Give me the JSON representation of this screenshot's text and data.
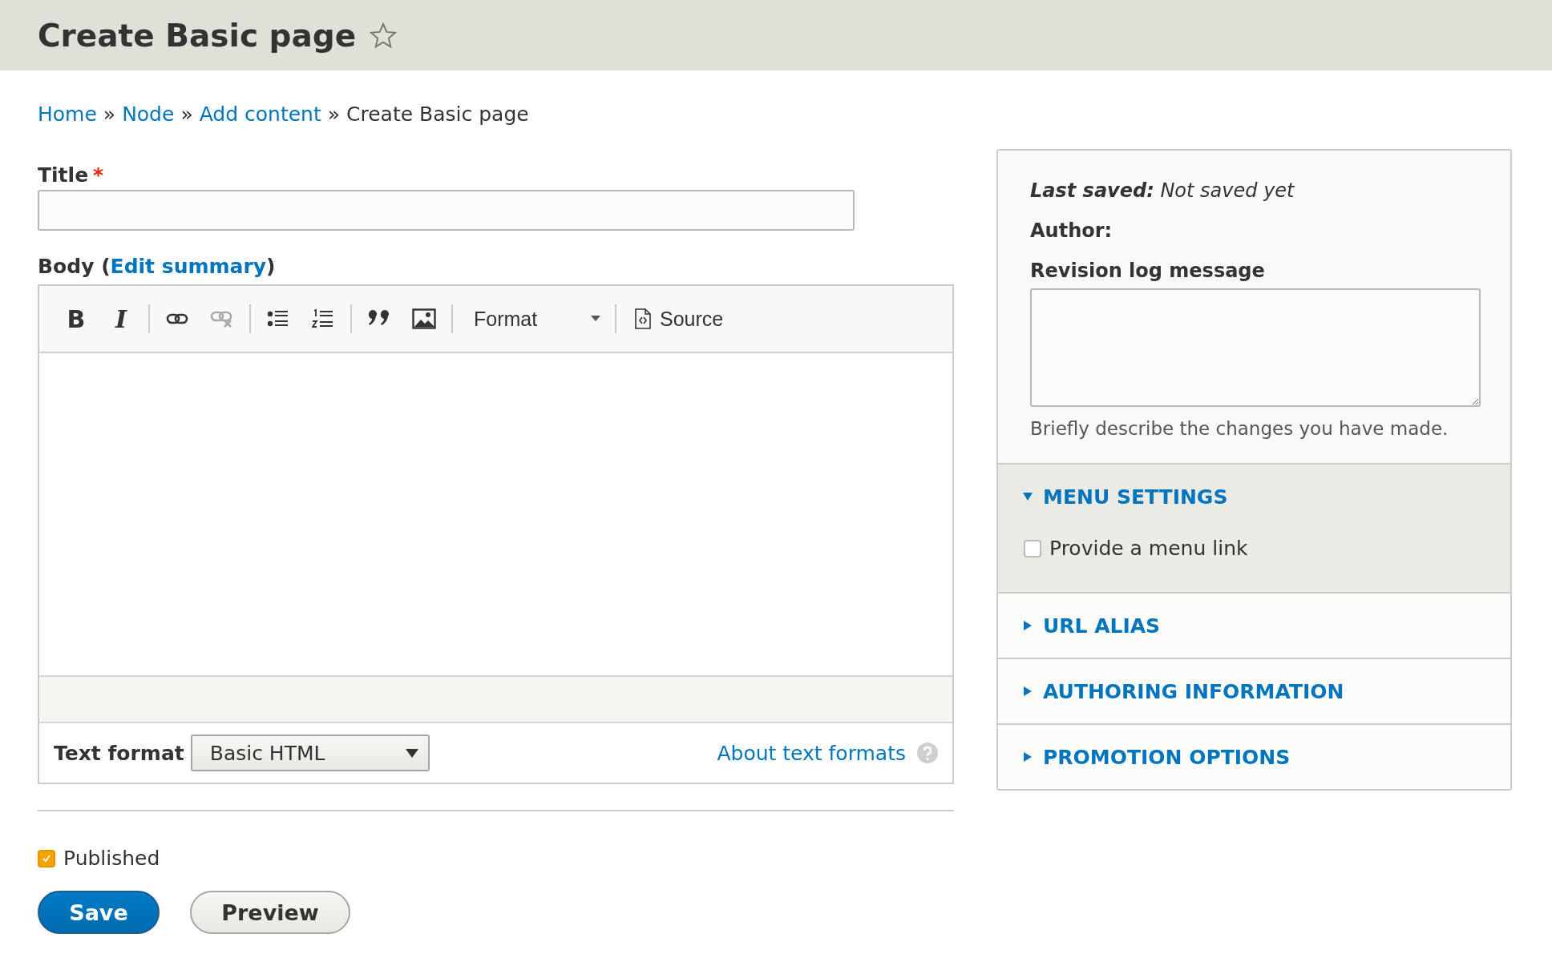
{
  "page_title": "Create Basic page",
  "breadcrumb": [
    {
      "kind": "link",
      "label": "Home"
    },
    {
      "kind": "separator",
      "label": "»"
    },
    {
      "kind": "link",
      "label": "Node"
    },
    {
      "kind": "separator",
      "label": "»"
    },
    {
      "kind": "link",
      "label": "Add content"
    },
    {
      "kind": "separator",
      "label": "»"
    },
    {
      "kind": "current",
      "label": "Create Basic page"
    }
  ],
  "title_field": {
    "label": "Title",
    "required_mark": "*"
  },
  "body": {
    "label_before": "Body (",
    "link": "Edit summary",
    "label_after": ")"
  },
  "toolbar": [
    [
      {
        "kind": "bold",
        "label": "B",
        "disabled": false
      },
      {
        "kind": "italic",
        "label": "I",
        "disabled": false
      }
    ],
    [
      {
        "kind": "link",
        "disabled": false
      },
      {
        "kind": "unlink",
        "disabled": true
      }
    ],
    [
      {
        "kind": "bullets",
        "disabled": false
      },
      {
        "kind": "numbers",
        "disabled": false
      }
    ],
    [
      {
        "kind": "quote",
        "disabled": false
      },
      {
        "kind": "image",
        "disabled": false
      }
    ],
    [
      {
        "kind": "format",
        "label": "Format",
        "disabled": false
      }
    ],
    [
      {
        "kind": "source",
        "label": "Source",
        "disabled": false
      }
    ]
  ],
  "text_format": {
    "label": "Text format",
    "selected": "Basic HTML",
    "help_link": "About text formats"
  },
  "published": {
    "label": "Published",
    "checked": true
  },
  "buttons": [
    {
      "kind": "primary",
      "label": "Save"
    },
    {
      "kind": "secondary",
      "label": "Preview"
    }
  ],
  "sidebar": {
    "last_saved": "**Last saved:** Not saved yet",
    "author_label": "Author:",
    "revision_label": "Revision log message",
    "revision_hint": "Briefly describe the changes you have made.",
    "sections": [
      {
        "title": "MENU SETTINGS",
        "expanded": true,
        "options": [
          {
            "label": "Provide a menu link",
            "checked": false
          }
        ]
      },
      {
        "title": "URL ALIAS",
        "expanded": false
      },
      {
        "title": "AUTHORING INFORMATION",
        "expanded": false
      },
      {
        "title": "PROMOTION OPTIONS",
        "expanded": false
      }
    ]
  }
}
